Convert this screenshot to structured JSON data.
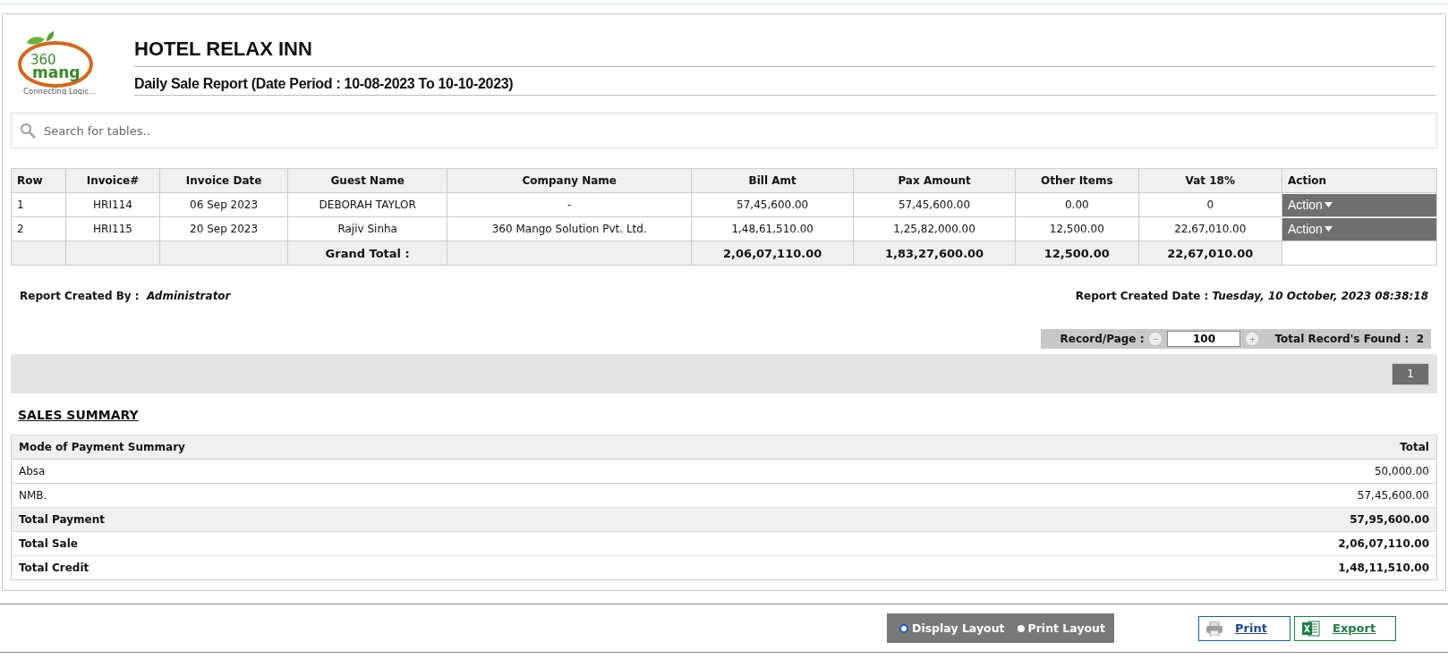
{
  "logo": {
    "number": "360",
    "word": "mang",
    "tagline": "Connecting Logic..."
  },
  "hotel_name": "HOTEL RELAX INN",
  "report_title": "Daily Sale Report (Date Period : 10-08-2023 To 10-10-2023)",
  "search": {
    "placeholder": "Search for tables.."
  },
  "table": {
    "columns": [
      "Row",
      "Invoice#",
      "Invoice Date",
      "Guest Name",
      "Company Name",
      "Bill Amt",
      "Pax Amount",
      "Other Items",
      "Vat 18%",
      "Action"
    ],
    "rows": [
      {
        "cells": [
          "1",
          "HRI114",
          "06 Sep 2023",
          "DEBORAH TAYLOR",
          "-",
          "57,45,600.00",
          "57,45,600.00",
          "0.00",
          "0"
        ],
        "action": "Action"
      },
      {
        "cells": [
          "2",
          "HRI115",
          "20 Sep 2023",
          "Rajiv Sinha",
          "360 Mango Solution Pvt. Ltd.",
          "1,48,61,510.00",
          "1,25,82,000.00",
          "12,500.00",
          "22,67,010.00"
        ],
        "action": "Action"
      }
    ],
    "total_row": {
      "label": "Grand Total :",
      "values": [
        "2,06,07,110.00",
        "1,83,27,600.00",
        "12,500.00",
        "22,67,010.00"
      ]
    }
  },
  "created_by": {
    "label": "Report Created By :",
    "value": "Administrator"
  },
  "created_date": {
    "label": "Report Created Date :",
    "value": "Tuesday, 10 October, 2023 08:38:18"
  },
  "paging": {
    "label": "Record/Page :",
    "minus": "−",
    "value": "100",
    "plus": "+",
    "found_label": "Total Record's Found :",
    "found": "2"
  },
  "pages": [
    {
      "label": "1",
      "selected": true
    }
  ],
  "summary": {
    "title": "SALES SUMMARY",
    "rows": [
      {
        "kind": "header",
        "label": "Mode of Payment Summary",
        "value": "Total"
      },
      {
        "kind": "item",
        "label": "Absa",
        "value": "50,000.00"
      },
      {
        "kind": "item",
        "label": "NMB.",
        "value": "57,45,600.00"
      },
      {
        "kind": "subtotal",
        "label": "Total Payment",
        "value": "57,95,600.00"
      },
      {
        "kind": "total",
        "label": "Total Sale",
        "value": "2,06,07,110.00"
      },
      {
        "kind": "total",
        "label": "Total Credit",
        "value": "1,48,11,510.00"
      }
    ]
  },
  "layouts": [
    {
      "label": "Display Layout",
      "selected": true
    },
    {
      "label": "Print Layout",
      "selected": false
    }
  ],
  "buttons": [
    {
      "kind": "print",
      "label": "Print"
    },
    {
      "kind": "export",
      "label": "Export"
    }
  ]
}
